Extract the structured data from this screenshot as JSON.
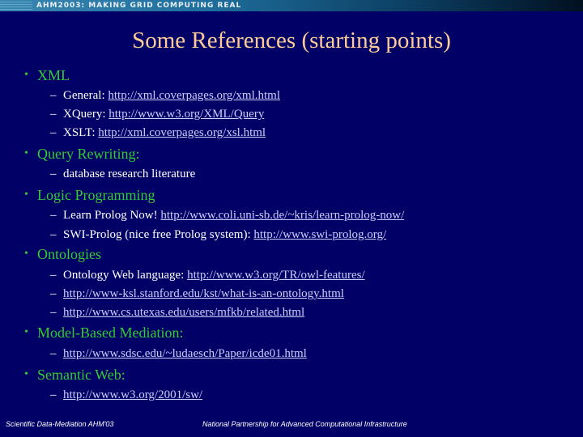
{
  "header": {
    "text": "AHM2003: MAKING GRID COMPUTING REAL"
  },
  "title": "Some References (starting points)",
  "colors": {
    "background": "#000066",
    "title": "#ffcc99",
    "bullet": "#33cc33",
    "link": "#ccccff",
    "text": "#ffffff"
  },
  "bullets": [
    {
      "label": "XML",
      "items": [
        {
          "text": "General: ",
          "link": "http://xml.coverpages.org/xml.html"
        },
        {
          "text": "XQuery: ",
          "link": "http://www.w3.org/XML/Query"
        },
        {
          "text": "XSLT: ",
          "link": "http://xml.coverpages.org/xsl.html"
        }
      ]
    },
    {
      "label": "Query Rewriting:",
      "items": [
        {
          "text": "database research literature",
          "link": ""
        }
      ]
    },
    {
      "label": "Logic Programming",
      "items": [
        {
          "text": "Learn Prolog Now!  ",
          "link": "http://www.coli.uni-sb.de/~kris/learn-prolog-now/"
        },
        {
          "text": "SWI-Prolog (nice free Prolog system): ",
          "link": "http://www.swi-prolog.org/"
        }
      ]
    },
    {
      "label": "Ontologies",
      "items": [
        {
          "text": "Ontology Web language: ",
          "link": "http://www.w3.org/TR/owl-features/"
        },
        {
          "text": "",
          "link": "http://www-ksl.stanford.edu/kst/what-is-an-ontology.html"
        },
        {
          "text": "",
          "link": "http://www.cs.utexas.edu/users/mfkb/related.html"
        }
      ]
    },
    {
      "label": "Model-Based Mediation:",
      "items": [
        {
          "text": "",
          "link": "http://www.sdsc.edu/~ludaesch/Paper/icde01.html"
        }
      ]
    },
    {
      "label": "Semantic Web:",
      "items": [
        {
          "text": "",
          "link": "http://www.w3.org/2001/sw/"
        }
      ]
    }
  ],
  "markers": {
    "bullet": "•",
    "dash": "–"
  },
  "footer": {
    "left": "Scientific Data-Mediation AHM'03",
    "right": "National Partnership for Advanced Computational Infrastructure"
  }
}
